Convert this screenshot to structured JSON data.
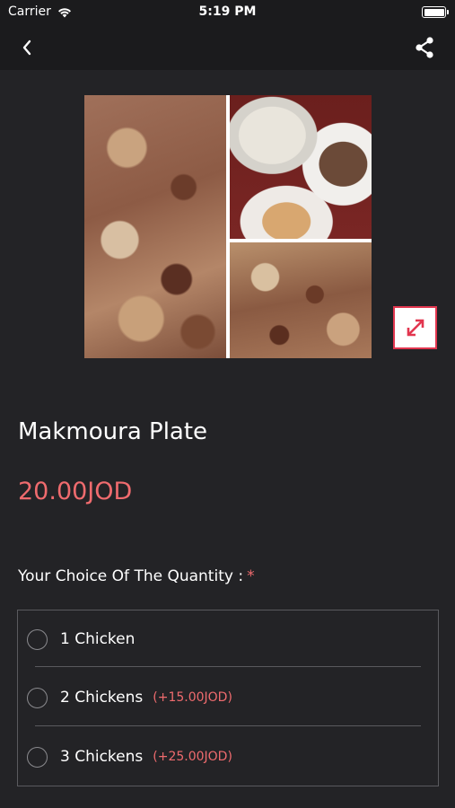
{
  "status_bar": {
    "carrier": "Carrier",
    "time": "5:19 PM"
  },
  "nav": {
    "back_icon": "chevron-left-icon",
    "share_icon": "share-icon"
  },
  "gallery": {
    "expand_icon": "expand-arrows-icon"
  },
  "product": {
    "title": "Makmoura Plate",
    "price": "20.00JOD"
  },
  "choice": {
    "heading": "Your Choice Of The Quantity :",
    "required_mark": "*",
    "options": [
      {
        "label": "1 Chicken",
        "extra": ""
      },
      {
        "label": "2 Chickens",
        "extra": "(+15.00JOD)"
      },
      {
        "label": "3 Chickens",
        "extra": "(+25.00JOD)"
      }
    ]
  },
  "colors": {
    "background": "#232326",
    "accent": "#ef6b6e",
    "expand_border": "#e2364f"
  }
}
